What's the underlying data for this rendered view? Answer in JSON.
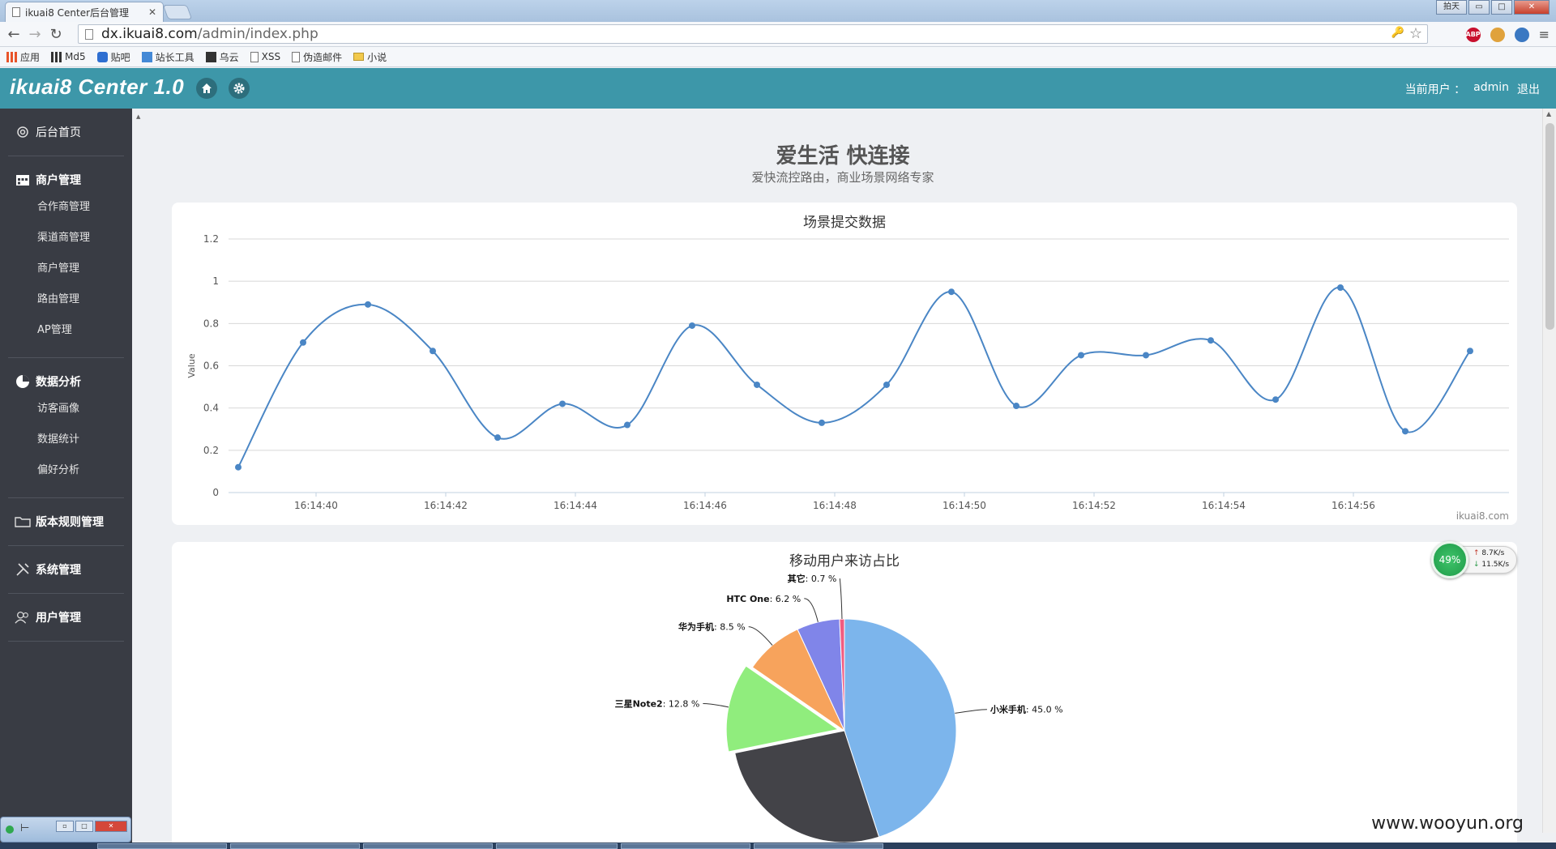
{
  "browser": {
    "tab_title": "ikuai8 Center后台管理",
    "tab_close": "✕",
    "url_host": "dx.ikuai8.com",
    "url_path": "/admin/index.php",
    "window_buttons": [
      "拍天",
      "▭",
      "□",
      "✕"
    ],
    "extensions": [
      "ABP"
    ],
    "bookmarks": [
      {
        "icon": "apps-icon",
        "label": "应用"
      },
      {
        "icon": "grid-icon",
        "label": "Md5"
      },
      {
        "icon": "paw-icon",
        "label": "贴吧"
      },
      {
        "icon": "tool-icon",
        "label": "站长工具"
      },
      {
        "icon": "wooyun-icon",
        "label": "乌云"
      },
      {
        "icon": "doc-icon",
        "label": "XSS"
      },
      {
        "icon": "doc-icon",
        "label": "伪造邮件"
      },
      {
        "icon": "folder-icon",
        "label": "小说"
      }
    ]
  },
  "app": {
    "brand": "ikuai8 Center 1.0",
    "user_label": "当前用户 ：",
    "username": "admin",
    "logout": "退出"
  },
  "sidebar": {
    "home": "后台首页",
    "groups": [
      {
        "label": "商户管理",
        "icon": "calendar-icon",
        "items": [
          "合作商管理",
          "渠道商管理",
          "商户管理",
          "路由管理",
          "AP管理"
        ]
      },
      {
        "label": "数据分析",
        "icon": "pie-icon",
        "items": [
          "访客画像",
          "数据统计",
          "偏好分析"
        ]
      }
    ],
    "version": "版本规则管理",
    "system": "系统管理",
    "users": "用户管理"
  },
  "page": {
    "title": "爱生活 快连接",
    "subtitle": "爱快流控路由，商业场景网络专家"
  },
  "chart_data": [
    {
      "type": "line",
      "title": "场景提交数据",
      "ylabel": "Value",
      "xlabel": "",
      "ylim": [
        0,
        1.2
      ],
      "yticks": [
        "0",
        "0.2",
        "0.4",
        "0.6",
        "0.8",
        "1",
        "1.2"
      ],
      "xticks": [
        "16:14:40",
        "16:14:42",
        "16:14:44",
        "16:14:46",
        "16:14:48",
        "16:14:50",
        "16:14:52",
        "16:14:54",
        "16:14:56"
      ],
      "x": [
        "16:14:38.8",
        "16:14:39.8",
        "16:14:40.8",
        "16:14:41.8",
        "16:14:42.8",
        "16:14:43.8",
        "16:14:44.8",
        "16:14:45.8",
        "16:14:46.8",
        "16:14:47.8",
        "16:14:48.8",
        "16:14:49.8",
        "16:14:50.8",
        "16:14:51.8",
        "16:14:52.8",
        "16:14:53.8",
        "16:14:54.8",
        "16:14:55.8",
        "16:14:56.8",
        "16:14:57.8"
      ],
      "values": [
        0.12,
        0.71,
        0.89,
        0.67,
        0.26,
        0.42,
        0.32,
        0.79,
        0.51,
        0.33,
        0.51,
        0.95,
        0.41,
        0.65,
        0.65,
        0.72,
        0.44,
        0.97,
        0.29,
        0.67
      ],
      "grid": true,
      "credit": "ikuai8.com",
      "color": "#4a86c5"
    },
    {
      "type": "pie",
      "title": "移动用户来访占比",
      "slices": [
        {
          "label": "小米手机",
          "value": 45.0,
          "display": "45.0 %",
          "color": "#7cb5ec"
        },
        {
          "label": "",
          "value": 26.8,
          "display": "",
          "color": "#434348"
        },
        {
          "label": "三星Note2",
          "value": 12.8,
          "display": "12.8 %",
          "color": "#90ed7d"
        },
        {
          "label": "华为手机",
          "value": 8.5,
          "display": "8.5 %",
          "color": "#f7a35c"
        },
        {
          "label": "HTC One",
          "value": 6.2,
          "display": "6.2 %",
          "color": "#8085e9"
        },
        {
          "label": "其它",
          "value": 0.7,
          "display": "0.7 %",
          "color": "#f15c80"
        }
      ]
    }
  ],
  "netmeter": {
    "percent": "49%",
    "up": "8.7K/s",
    "down": "11.5K/s"
  },
  "desktop": {
    "mini_window_label": "⊢",
    "watermark": "www.wooyun.org"
  }
}
